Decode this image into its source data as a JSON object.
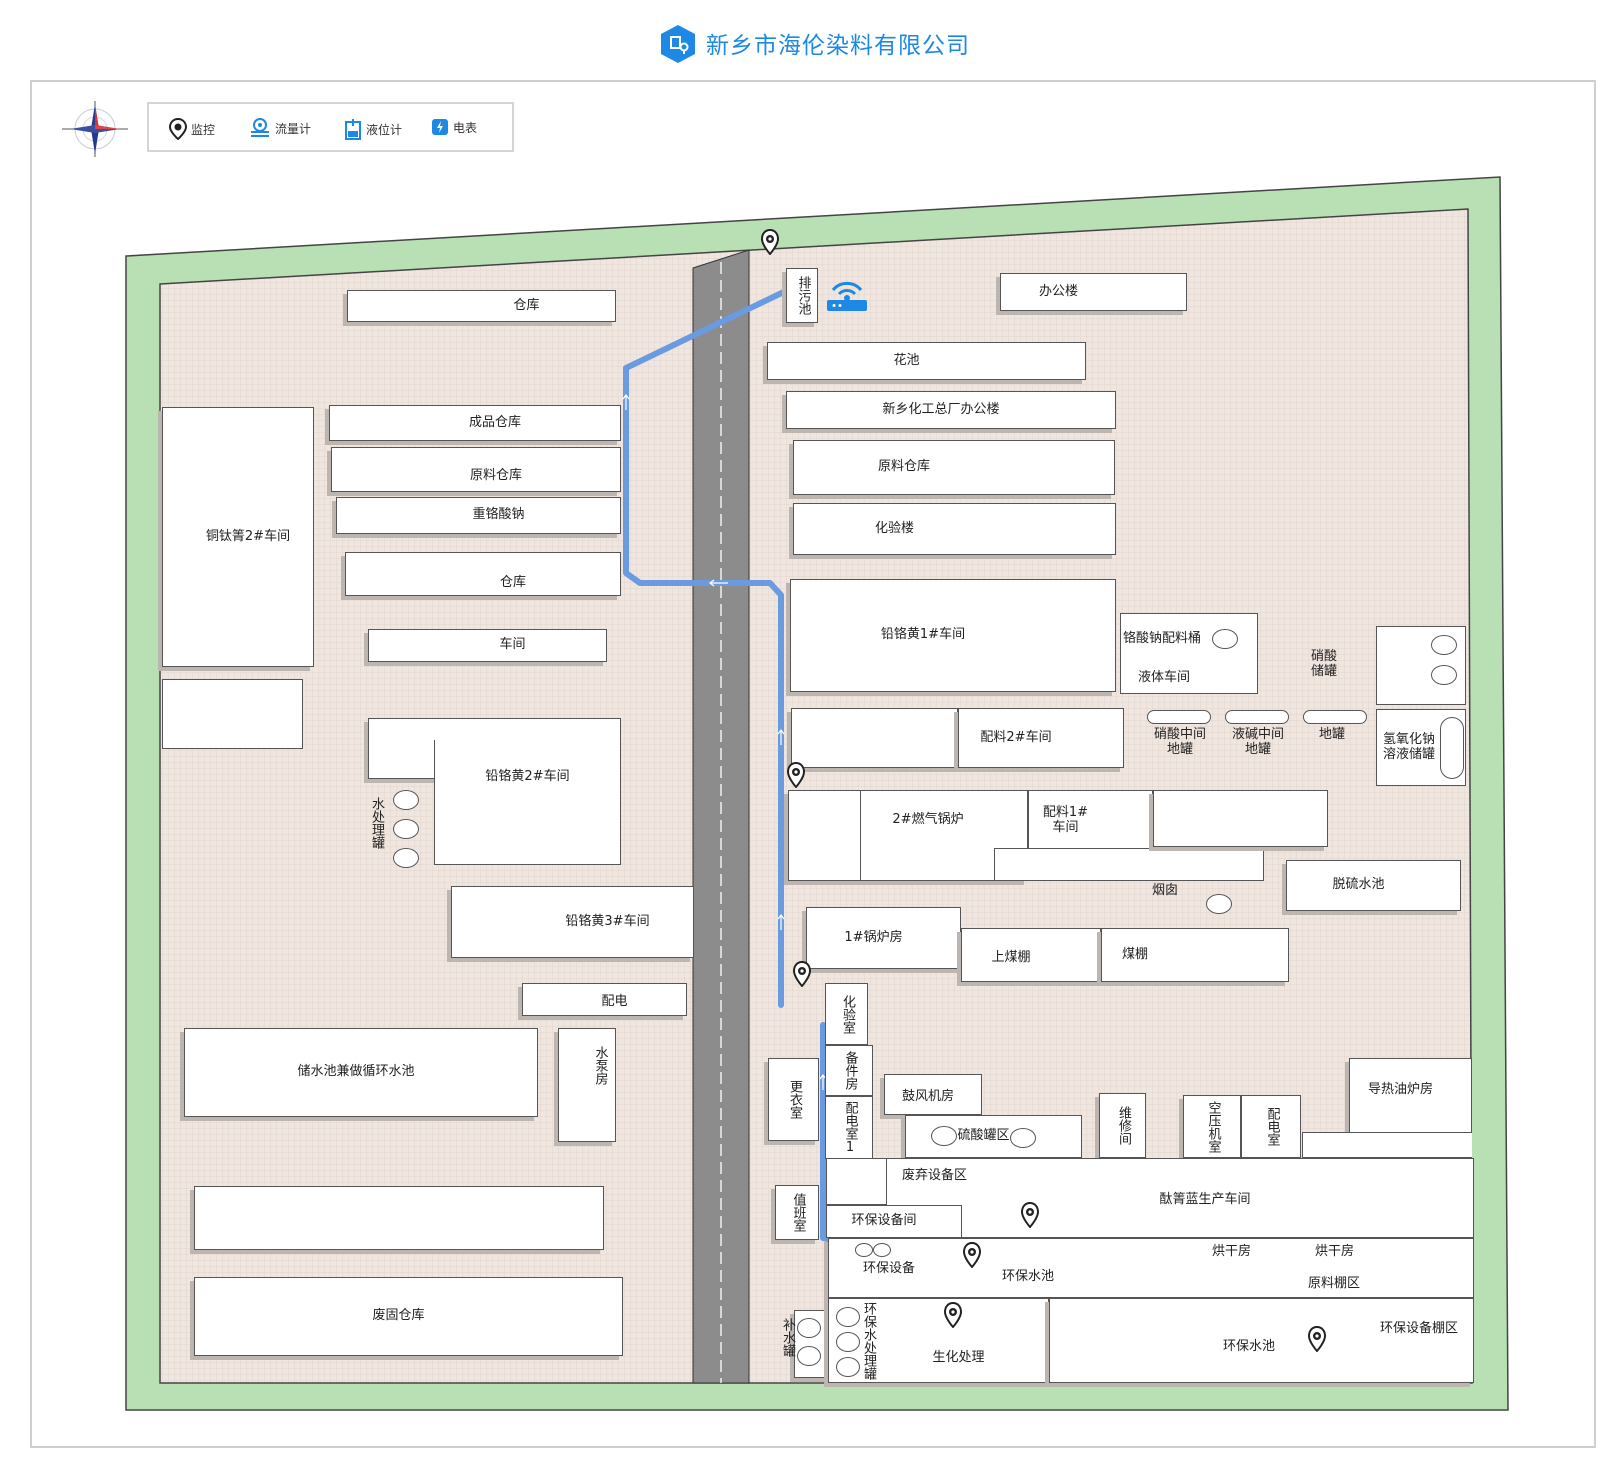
{
  "header": {
    "title": "新乡市海伦染料有限公司"
  },
  "legend": {
    "monitor": "监控",
    "flowmeter": "流量计",
    "level": "液位计",
    "meter": "电表"
  },
  "icons": {
    "logo": "building-location-icon",
    "compass": "compass-rose-icon",
    "monitor": "map-pin-icon",
    "flowmeter": "flowmeter-icon",
    "level": "level-gauge-icon",
    "meter": "electric-meter-icon",
    "sensor": "wifi-router-icon"
  },
  "colors": {
    "boundary": "#b8e0b4",
    "ground": "#efe7e2",
    "road": "#8c8c8c",
    "pipe": "#6a9be0",
    "accent": "#1e88e5"
  },
  "buildings": {
    "warehouse_top": "仓库",
    "sewage_pool": "排污池",
    "office": "办公楼",
    "flowerbed": "花池",
    "xinxiang_office": "新乡化工总厂办公楼",
    "finished_warehouse": "成品仓库",
    "raw_warehouse_left": "原料仓库",
    "raw_warehouse_right": "原料仓库",
    "sodium_dichromate": "重铬酸钠",
    "lab_building": "化验楼",
    "copper_workshop": "铜钛箐2#车间",
    "warehouse_mid": "仓库",
    "lead_chrome_1": "铅铬黄1#车间",
    "chromate_tank": "铬酸钠配料桶",
    "liquid_workshop": "液体车间",
    "nitric_tank": "硝酸储罐",
    "workshop": "车间",
    "mix2": "配料2#车间",
    "nitric_mid": "硝酸中间地罐",
    "alkali_mid": "液碱中间地罐",
    "ground_tank": "地罐",
    "naoh_tank": "氢氧化钠溶液储罐",
    "lead_chrome_2": "铅铬黄2#车间",
    "water_tank": "水处理罐",
    "gas_boiler": "2#燃气锅炉",
    "mix1": "配料1#车间",
    "chimney": "烟囱",
    "desulfur": "脱硫水池",
    "lead_chrome_3": "铅铬黄3#车间",
    "boiler1": "1#锅炉房",
    "coal_shed_upper": "上煤棚",
    "coal_shed": "煤棚",
    "power": "配电",
    "lab_room": "化验室",
    "spare_room": "备件房",
    "storage_pool": "储水池兼做循环水池",
    "pump_room": "水泵房",
    "changing_room": "更衣室",
    "power_room1": "配电室1",
    "blower": "鼓风机房",
    "sulfuric": "硫酸罐区",
    "repair": "维修间",
    "compressor": "空压机室",
    "power_room": "配电室",
    "heat_oil": "导热油炉房",
    "waste_equipment": "废弃设备区",
    "phthalo_blue": "酞箐蓝生产车间",
    "duty_room": "值班室",
    "env_equip_room": "环保设备间",
    "env_equip": "环保设备",
    "env_pool": "环保水池",
    "dry_room_a": "烘干房",
    "dry_room_b": "烘干房",
    "raw_shed": "原料棚区",
    "solid_waste": "废固仓库",
    "makeup_tank": "补水罐",
    "env_water_treat": "环保水处理罐",
    "biochem": "生化处理",
    "env_pool2": "环保水池",
    "env_shed": "环保设备棚区"
  }
}
